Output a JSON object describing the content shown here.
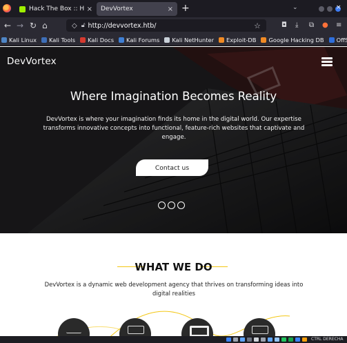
{
  "browser": {
    "tabs": [
      {
        "label": "Hack The Box :: Hack The",
        "close": "×",
        "active": false
      },
      {
        "label": "DevVortex",
        "close": "×",
        "active": true
      }
    ],
    "new_tab": "+",
    "tabs_list": "⌄",
    "url": "http://devvortex.htb/",
    "bookmarks": [
      {
        "label": "Kali Linux",
        "color": "#4f86c6"
      },
      {
        "label": "Kali Tools",
        "color": "#3e6fb8"
      },
      {
        "label": "Kali Docs",
        "color": "#d63a2f"
      },
      {
        "label": "Kali Forums",
        "color": "#3f7fd4"
      },
      {
        "label": "Kali NetHunter",
        "color": "#c9d1d9"
      },
      {
        "label": "Exploit-DB",
        "color": "#f08a24"
      },
      {
        "label": "Google Hacking DB",
        "color": "#f08a24"
      },
      {
        "label": "OffSec",
        "color": "#2f6fdd"
      }
    ]
  },
  "site": {
    "brand": "DevVortex",
    "hero": {
      "headline": "Where Imagination Becomes Reality",
      "lede": "DevVortex is where your imagination finds its home in the digital world. Our expertise transforms innovative concepts into functional, feature-rich websites that captivate and engage.",
      "cta": "Contact us",
      "slides": 3
    },
    "what_we_do": {
      "title": "WHAT WE DO",
      "text": "DevVortex is a dynamic web development agency that thrives on transforming ideas into digital realities"
    }
  },
  "taskbar": {
    "tray_text": "CTRL DERECHA"
  },
  "colors": {
    "accent": "#f3c612",
    "active_tab": "#42414d",
    "hero_bg": "#1b1a1b"
  }
}
